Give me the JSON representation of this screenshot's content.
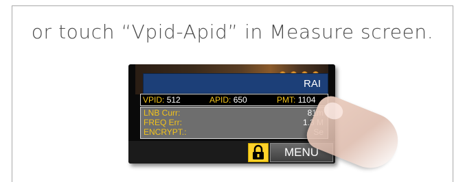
{
  "headline": "or touch “Vpid-Apid” in Measure screen.",
  "screen": {
    "channel": "RAI",
    "pids": [
      {
        "label": "VPID:",
        "value": "512"
      },
      {
        "label": "APID:",
        "value": "650"
      },
      {
        "label": "PMT:",
        "value": "1104"
      }
    ],
    "info": [
      {
        "label": "LNB Curr:",
        "value": "81m"
      },
      {
        "label": "FREQ Err:",
        "value": "1.3 M"
      },
      {
        "label": "ENCRYPT.:",
        "value": "Se"
      }
    ],
    "lock_icon": "lock-icon",
    "menu_label": "MENU"
  },
  "colors": {
    "label_yellow": "#f2c31b",
    "channel_bar": "#1c3f78",
    "lock_button": "#ffd22a"
  }
}
